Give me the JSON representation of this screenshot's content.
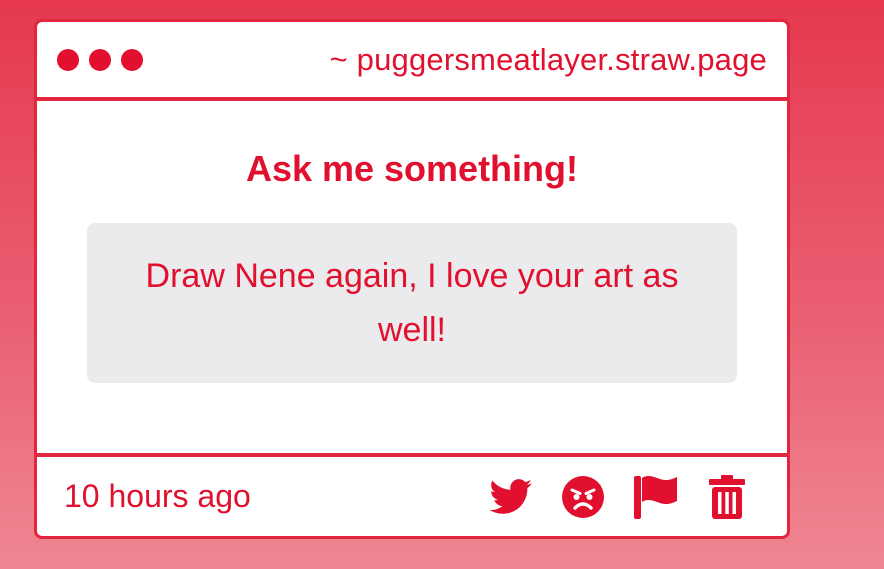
{
  "window": {
    "url": "~ puggersmeatlayer.straw.page"
  },
  "main": {
    "heading": "Ask me something!",
    "question": "Draw Nene again, I love your art as well!"
  },
  "footer": {
    "timestamp": "10 hours ago",
    "actions": [
      {
        "icon": "twitter-icon"
      },
      {
        "icon": "angry-face-icon"
      },
      {
        "icon": "flag-icon"
      },
      {
        "icon": "trash-icon"
      }
    ]
  },
  "colors": {
    "accent": "#e1102e",
    "border": "#e1263d",
    "question_bg": "#ebebed",
    "background_top": "#e5384f",
    "background_bottom": "#ef8792"
  }
}
